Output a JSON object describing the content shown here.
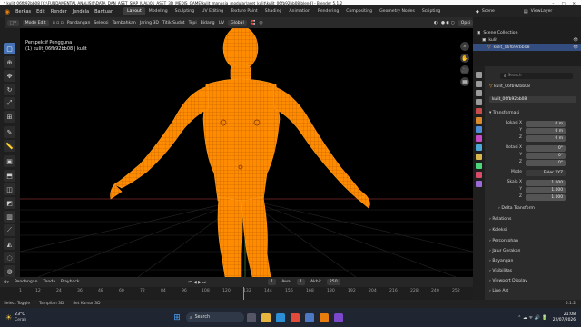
{
  "window": {
    "title": "* kulit_06fb92bb08 [C:\\FUNDAMENTAL ANALISIS\\DATA_DAN_ASET_SIAP_JUAL\\01_ASET_3D_MEDIS_GAME\\kulit_manusia_modular\\aset_kulit\\kulit_06fb92bb08.blend] - Blender 5.1.2"
  },
  "menu": {
    "items": [
      "Berkas",
      "Edit",
      "Render",
      "Jendela",
      "Bantuan"
    ],
    "workspaces": [
      "Layout",
      "Modeling",
      "Sculpting",
      "UV Editing",
      "Texture Paint",
      "Shading",
      "Animation",
      "Rendering",
      "Compositing",
      "Geometry Nodes",
      "Scripting"
    ],
    "scene": "Scene",
    "view_layer": "ViewLayer"
  },
  "viewport_header": {
    "mode": "Mode Edit",
    "menus": [
      "Pandangan",
      "Seleksi",
      "Tambahkan",
      "Jaring 3D",
      "Titik Sudut",
      "Tepi",
      "Bidang",
      "UV"
    ],
    "orientation": "Global",
    "options": "Opsi"
  },
  "viewport_info": {
    "perspective": "Perspektif Pengguna",
    "object": "(1) kulit_06fb92bb08 | kulit"
  },
  "timeline": {
    "menus": [
      "Pendangan",
      "Tanda",
      "Playback"
    ],
    "current_frame": "1",
    "start_label": "Awal",
    "start": "1",
    "end_label": "Akhir",
    "end": "250",
    "ticks": [
      "1",
      "12",
      "24",
      "36",
      "48",
      "60",
      "72",
      "84",
      "96",
      "108",
      "120",
      "132",
      "144",
      "156",
      "168",
      "180",
      "192",
      "204",
      "216",
      "228",
      "240",
      "252"
    ]
  },
  "statusbar": {
    "items": [
      "Select Toggle",
      "Tampilan 3D",
      "Set Kursor 3D"
    ],
    "version": "5.1.2"
  },
  "taskbar": {
    "weather_temp": "23°C",
    "weather_desc": "Cerah",
    "search": "Search",
    "time": "21:08",
    "date": "22/07/2026"
  },
  "outliner": {
    "rows": [
      {
        "label": "Scene Collection",
        "selected": false
      },
      {
        "label": "kulit",
        "selected": false
      },
      {
        "label": "kulit_06fb92bb08",
        "selected": true
      }
    ]
  },
  "properties": {
    "search_placeholder": "Search",
    "object_name": "kulit_06fb92bb08",
    "object_name2": "kulit_06fb92bb08",
    "transform_header": "Transformasi",
    "location_label": "Lokasi X",
    "location": [
      "0 m",
      "0 m",
      "0 m"
    ],
    "rotation_label": "Rotasi X",
    "rotation": [
      "0°",
      "0°",
      "0°"
    ],
    "mode_label": "Mode",
    "mode_value": "Euler XYZ",
    "scale_label": "Skala X",
    "scale": [
      "1.000",
      "1.000",
      "1.000"
    ],
    "y_label": "Y",
    "z_label": "Z",
    "sections": [
      "Delta Transform",
      "Relations",
      "Koleksi",
      "Percontohan",
      "Jalur Gerakan",
      "Bayangan",
      "Visibilitas",
      "Viewport Display",
      "Line Art"
    ]
  },
  "colors": {
    "mesh": "#ff8c00",
    "wire": "#cc5a00",
    "accent": "#4772b3"
  }
}
